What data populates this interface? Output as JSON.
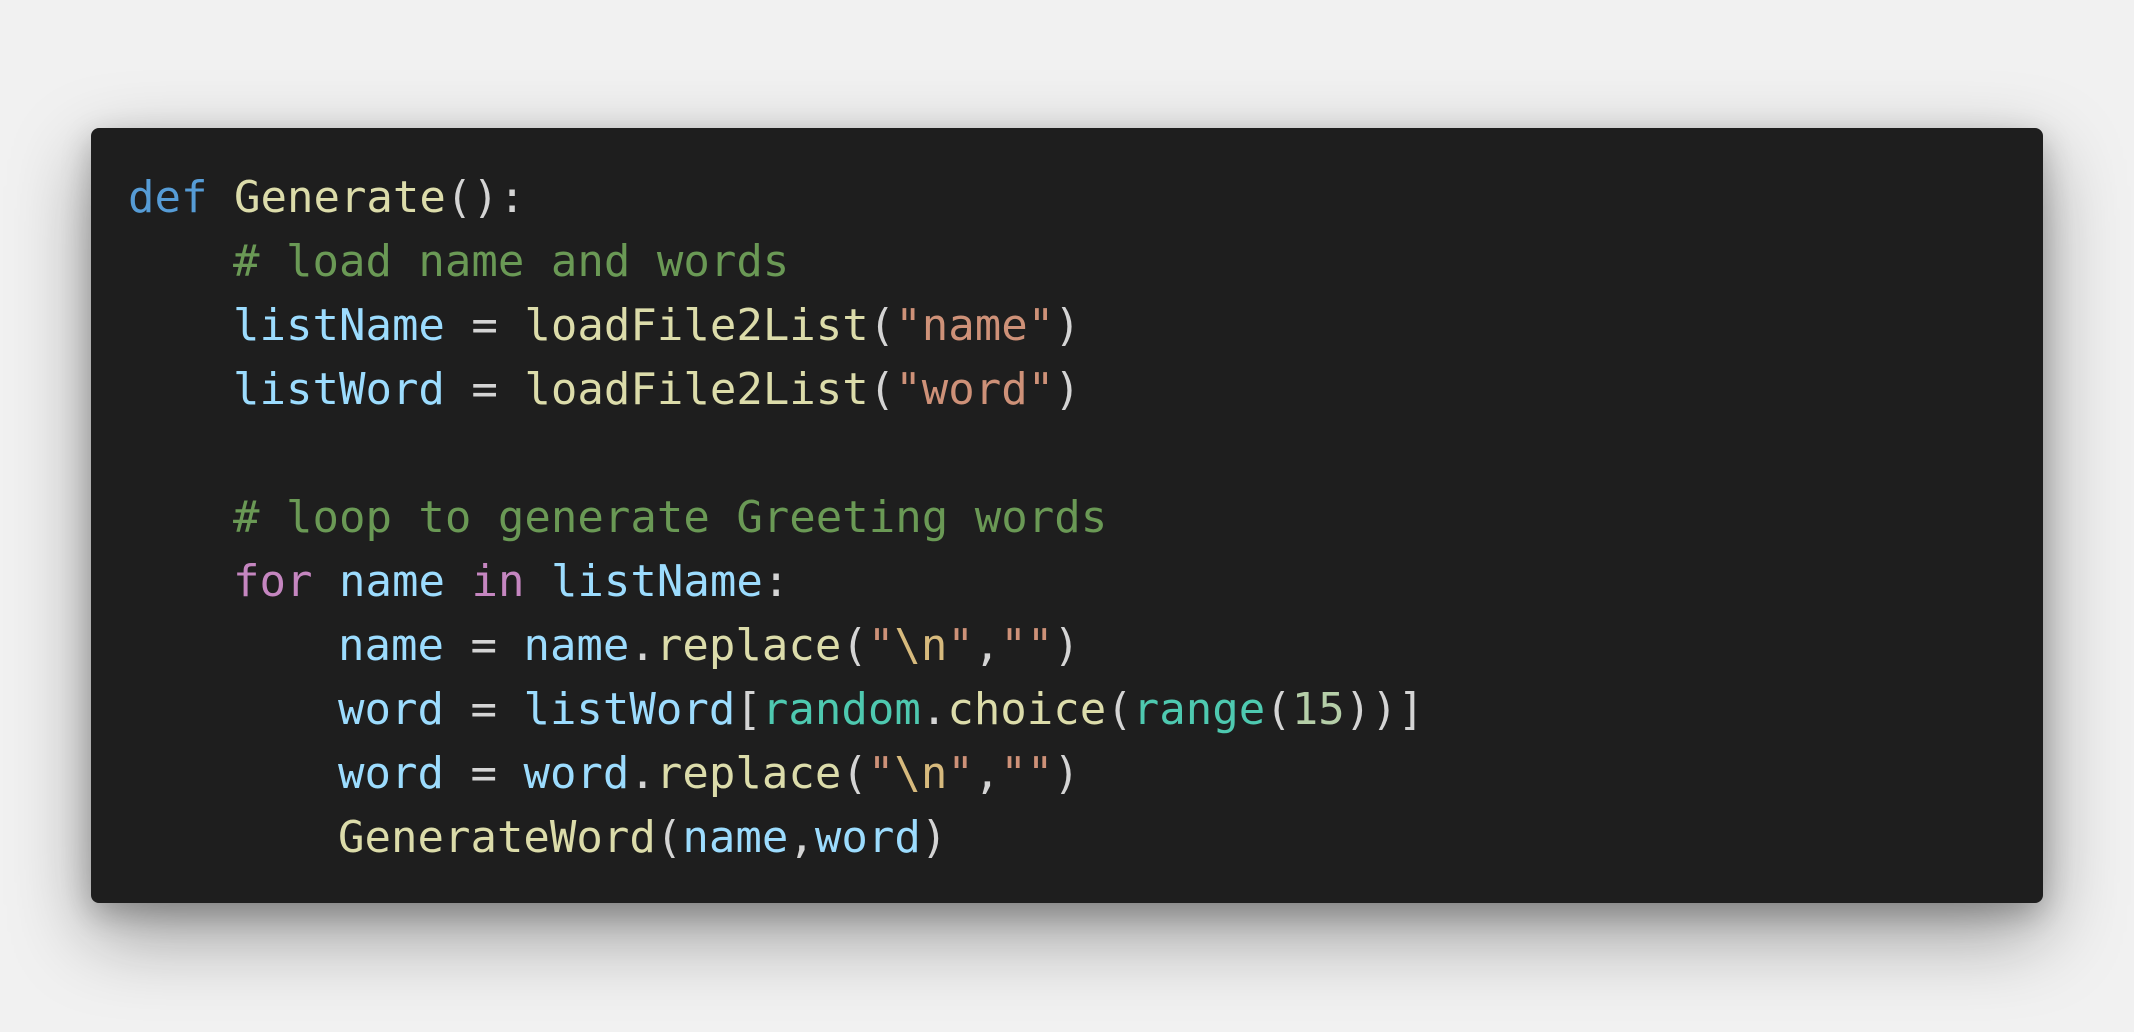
{
  "code": {
    "line1": {
      "kw": "def",
      "fn": "Generate",
      "punct": "():"
    },
    "line2": {
      "comment": "# load name and words"
    },
    "line3": {
      "var": "listName",
      "op": " = ",
      "fn": "loadFile2List",
      "open": "(",
      "str": "\"name\"",
      "close": ")"
    },
    "line4": {
      "var": "listWord",
      "op": " = ",
      "fn": "loadFile2List",
      "open": "(",
      "str": "\"word\"",
      "close": ")"
    },
    "line6": {
      "comment": "# loop to generate Greeting words"
    },
    "line7": {
      "kw": "for",
      "var1": "name",
      "kw2": "in",
      "var2": "listName",
      "punct": ":"
    },
    "line8": {
      "var": "name",
      "op": " = ",
      "obj": "name",
      "dot": ".",
      "fn": "replace",
      "open": "(",
      "q1": "\"",
      "esc": "\\n",
      "q2": "\"",
      "comma": ",",
      "str2": "\"\"",
      "close": ")"
    },
    "line9": {
      "var": "word",
      "op": " = ",
      "list": "listWord",
      "br_open": "[",
      "mod": "random",
      "dot": ".",
      "fn": "choice",
      "p1": "(",
      "fn2": "range",
      "p2": "(",
      "num": "15",
      "close": "))]"
    },
    "line10": {
      "var": "word",
      "op": " = ",
      "obj": "word",
      "dot": ".",
      "fn": "replace",
      "open": "(",
      "q1": "\"",
      "esc": "\\n",
      "q2": "\"",
      "comma": ",",
      "str2": "\"\"",
      "close": ")"
    },
    "line11": {
      "fn": "GenerateWord",
      "open": "(",
      "arg1": "name",
      "comma": ",",
      "arg2": "word",
      "close": ")"
    }
  },
  "colors": {
    "background": "#f1f1f1",
    "editor_bg": "#1e1e1e",
    "keyword": "#569cd6",
    "control": "#c586c0",
    "function": "#dcdcaa",
    "variable": "#9cdcfe",
    "string": "#ce9178",
    "comment": "#6a9955",
    "escape": "#d7ba7d",
    "type": "#4ec9b0",
    "number": "#b5cea8"
  }
}
